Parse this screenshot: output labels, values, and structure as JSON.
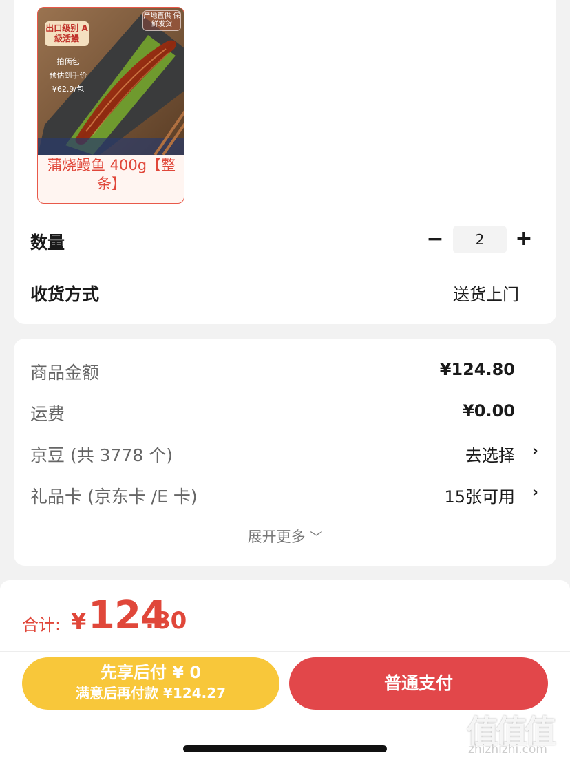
{
  "product": {
    "name": "蒲烧鳗鱼 400g【整条】",
    "badge_main": "出口级别 A級活鰻",
    "badge_lines": [
      "拍俩包",
      "预估到手价",
      "¥62.9/包"
    ],
    "corner_tag": "产地直供 保鲜发货"
  },
  "order": {
    "quantity_label": "数量",
    "quantity_value": "2",
    "delivery_label": "收货方式",
    "delivery_value": "送货上门"
  },
  "price": {
    "goods_label": "商品金额",
    "goods_value": "¥124.80",
    "shipping_label": "运费",
    "shipping_value": "¥0.00",
    "jingdou_label": "京豆 (共 3778 个)",
    "jingdou_action": "去选择",
    "giftcard_label": "礼品卡 (京东卡 /E 卡)",
    "giftcard_action": "15张可用",
    "expand_more": "展开更多"
  },
  "footer": {
    "total_label": "合计:",
    "total_currency": "¥",
    "total_int": "124",
    "total_dec": ".80",
    "later_pay_line1": "先享后付 ¥ 0",
    "later_pay_line2": "满意后再付款 ¥124.27",
    "pay_button": "普通支付"
  },
  "watermark": {
    "logo": "值值值",
    "site": "zhizhizhi.com"
  },
  "colors": {
    "accent_red": "#e0473a",
    "pay_red": "#e2474a",
    "later_yellow": "#f8c73a"
  }
}
